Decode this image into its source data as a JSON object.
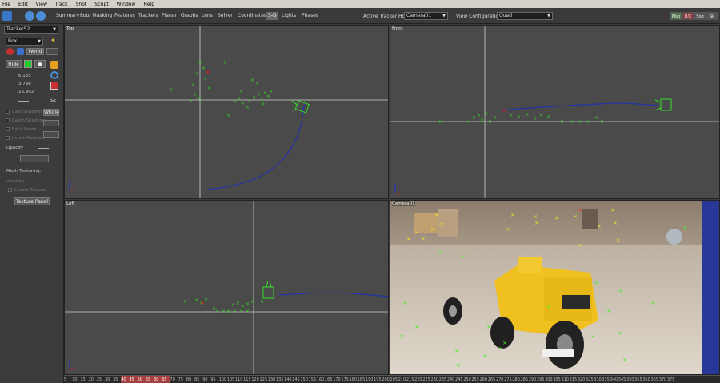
{
  "menu": [
    "File",
    "Edit",
    "View",
    "Track",
    "Shot",
    "Script",
    "Window",
    "Help"
  ],
  "toolbar": {
    "tabs": [
      "Summary",
      "Roto Masking",
      "Features",
      "Trackers",
      "Planar",
      "Graphs",
      "Lens",
      "Solver",
      "Coordinates",
      "3-D",
      "Lights",
      "Phases"
    ],
    "active_tab": "3-D",
    "tracker_host_label": "Active Tracker Host:",
    "tracker_host_value": "Camera01",
    "view_config_label": "View Configuration:",
    "view_config_value": "Quad",
    "right_buttons": [
      "Msg",
      "D/X",
      "Sog",
      "Sk"
    ]
  },
  "left_panel": {
    "tracker_select": "Tracker52",
    "shape_select": "Box",
    "world_button": "World",
    "hide_button": "Hide",
    "values": [
      "6.135",
      "3.798",
      "-16.992"
    ],
    "checkboxes": [
      "Cast Shadows",
      "Catch Shadows",
      "Back Faces",
      "Invert Normals"
    ],
    "whole_button": "Whole",
    "opacity_label": "Opacity",
    "mesh_texturing_label": "Mesh Texturing:",
    "none_text": "<none>",
    "create_texture": "Create Texture",
    "texture_panel_button": "Texture Panel"
  },
  "viewports": {
    "top": "Top",
    "front": "Front",
    "left": "Left",
    "camera": "Camera01"
  },
  "ruler": {
    "ticks": [
      "5",
      "10",
      "15",
      "20",
      "25",
      "30",
      "35",
      "40",
      "45",
      "50",
      "55",
      "60",
      "65",
      "70",
      "75",
      "80",
      "85",
      "90",
      "95",
      "100",
      "105",
      "110",
      "115",
      "120",
      "125",
      "130",
      "135",
      "140",
      "145",
      "150",
      "155",
      "160",
      "165",
      "170",
      "175",
      "180",
      "185",
      "190",
      "195",
      "200",
      "205",
      "210",
      "215",
      "220",
      "225",
      "230",
      "235",
      "240",
      "245",
      "250",
      "255",
      "260",
      "265",
      "270",
      "275",
      "280",
      "285",
      "290",
      "295",
      "300",
      "305",
      "310",
      "315",
      "320",
      "325",
      "330",
      "335",
      "340",
      "345",
      "350",
      "355",
      "360",
      "365",
      "370",
      "375"
    ]
  },
  "colors": {
    "tracker": "#33dd22",
    "path": "#2233aa",
    "grid": "#cfcfcf",
    "highlight": "#a64040"
  }
}
